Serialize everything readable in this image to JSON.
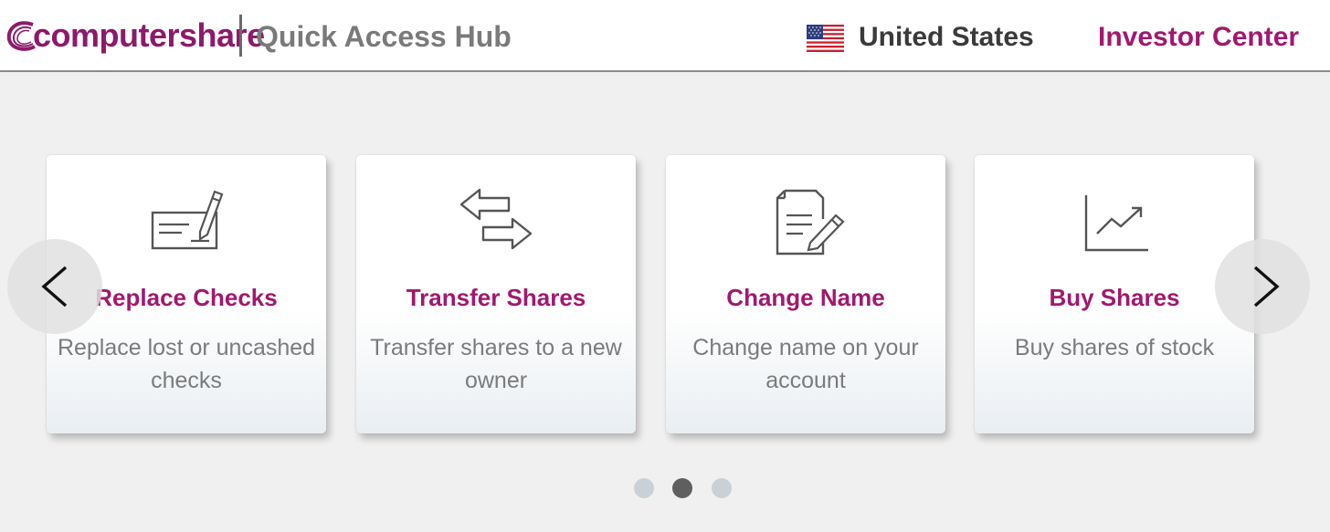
{
  "header": {
    "brand": "computershare",
    "app_title": "Quick Access Hub",
    "region": "United States",
    "investor_link": "Investor Center"
  },
  "colors": {
    "brand": "#a0196e",
    "text_muted": "#7b7b7b",
    "background": "#f0f0f0",
    "dot_active": "#5f5f5f",
    "dot_inactive": "#c9d0d6"
  },
  "cards": [
    {
      "icon": "check-pen-icon",
      "title": "Replace Checks",
      "description": "Replace lost or uncashed checks"
    },
    {
      "icon": "transfer-arrows-icon",
      "title": "Transfer Shares",
      "description": "Transfer shares to a new owner"
    },
    {
      "icon": "document-edit-icon",
      "title": "Change Name",
      "description": "Change name on your account"
    },
    {
      "icon": "line-chart-icon",
      "title": "Buy Shares",
      "description": "Buy shares of stock"
    }
  ],
  "carousel": {
    "prev_icon": "chevron-left-icon",
    "next_icon": "chevron-right-icon",
    "page_count": 3,
    "active_page": 2
  }
}
